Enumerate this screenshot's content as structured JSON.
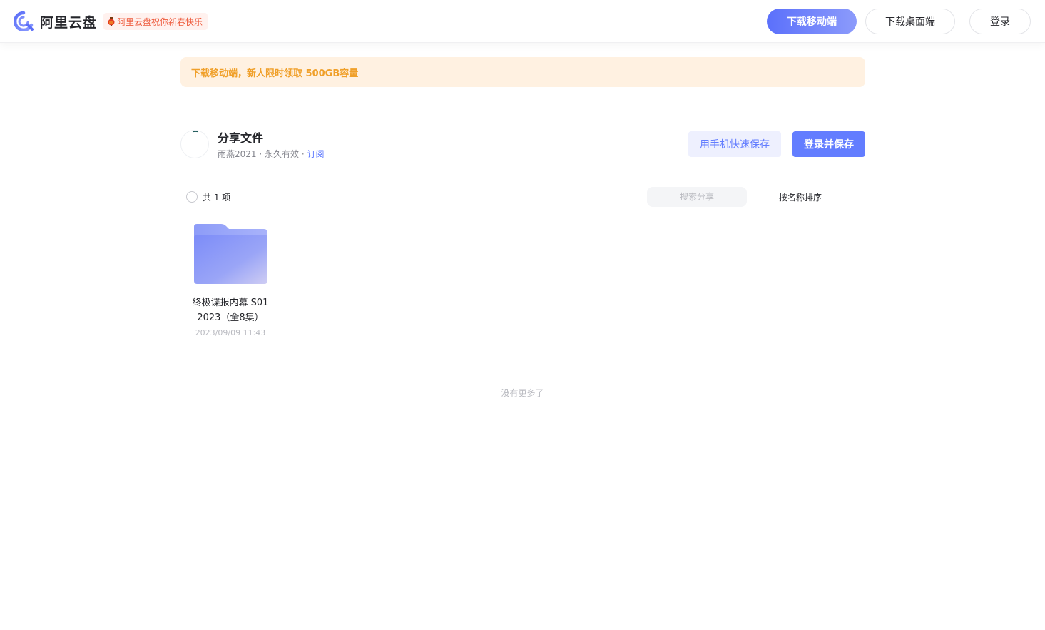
{
  "header": {
    "logo_text": "阿里云盘",
    "promo_text": "阿里云盘祝你新春快乐",
    "download_mobile_label": "下载移动端",
    "download_desktop_label": "下载桌面端",
    "login_label": "登录",
    "accent_color": "#637dff"
  },
  "banner": {
    "text": "下载移动端，新人限时领取 500GB容量"
  },
  "share": {
    "title": "分享文件",
    "owner": "雨燕2021",
    "separator": " · ",
    "validity": "永久有效",
    "subscribe_label": "订阅",
    "phone_save_label": "用手机快速保存",
    "login_save_label": "登录并保存"
  },
  "toolbar": {
    "count_text": "共 1 项",
    "search_placeholder": "搜索分享",
    "sort_label": "按名称排序"
  },
  "files": [
    {
      "icon": "folder-icon",
      "name_line1": "终极谍报内幕 S01",
      "name_line2": "2023（全8集）",
      "date": "2023/09/09 11:43"
    }
  ],
  "footer": {
    "no_more_text": "没有更多了"
  }
}
